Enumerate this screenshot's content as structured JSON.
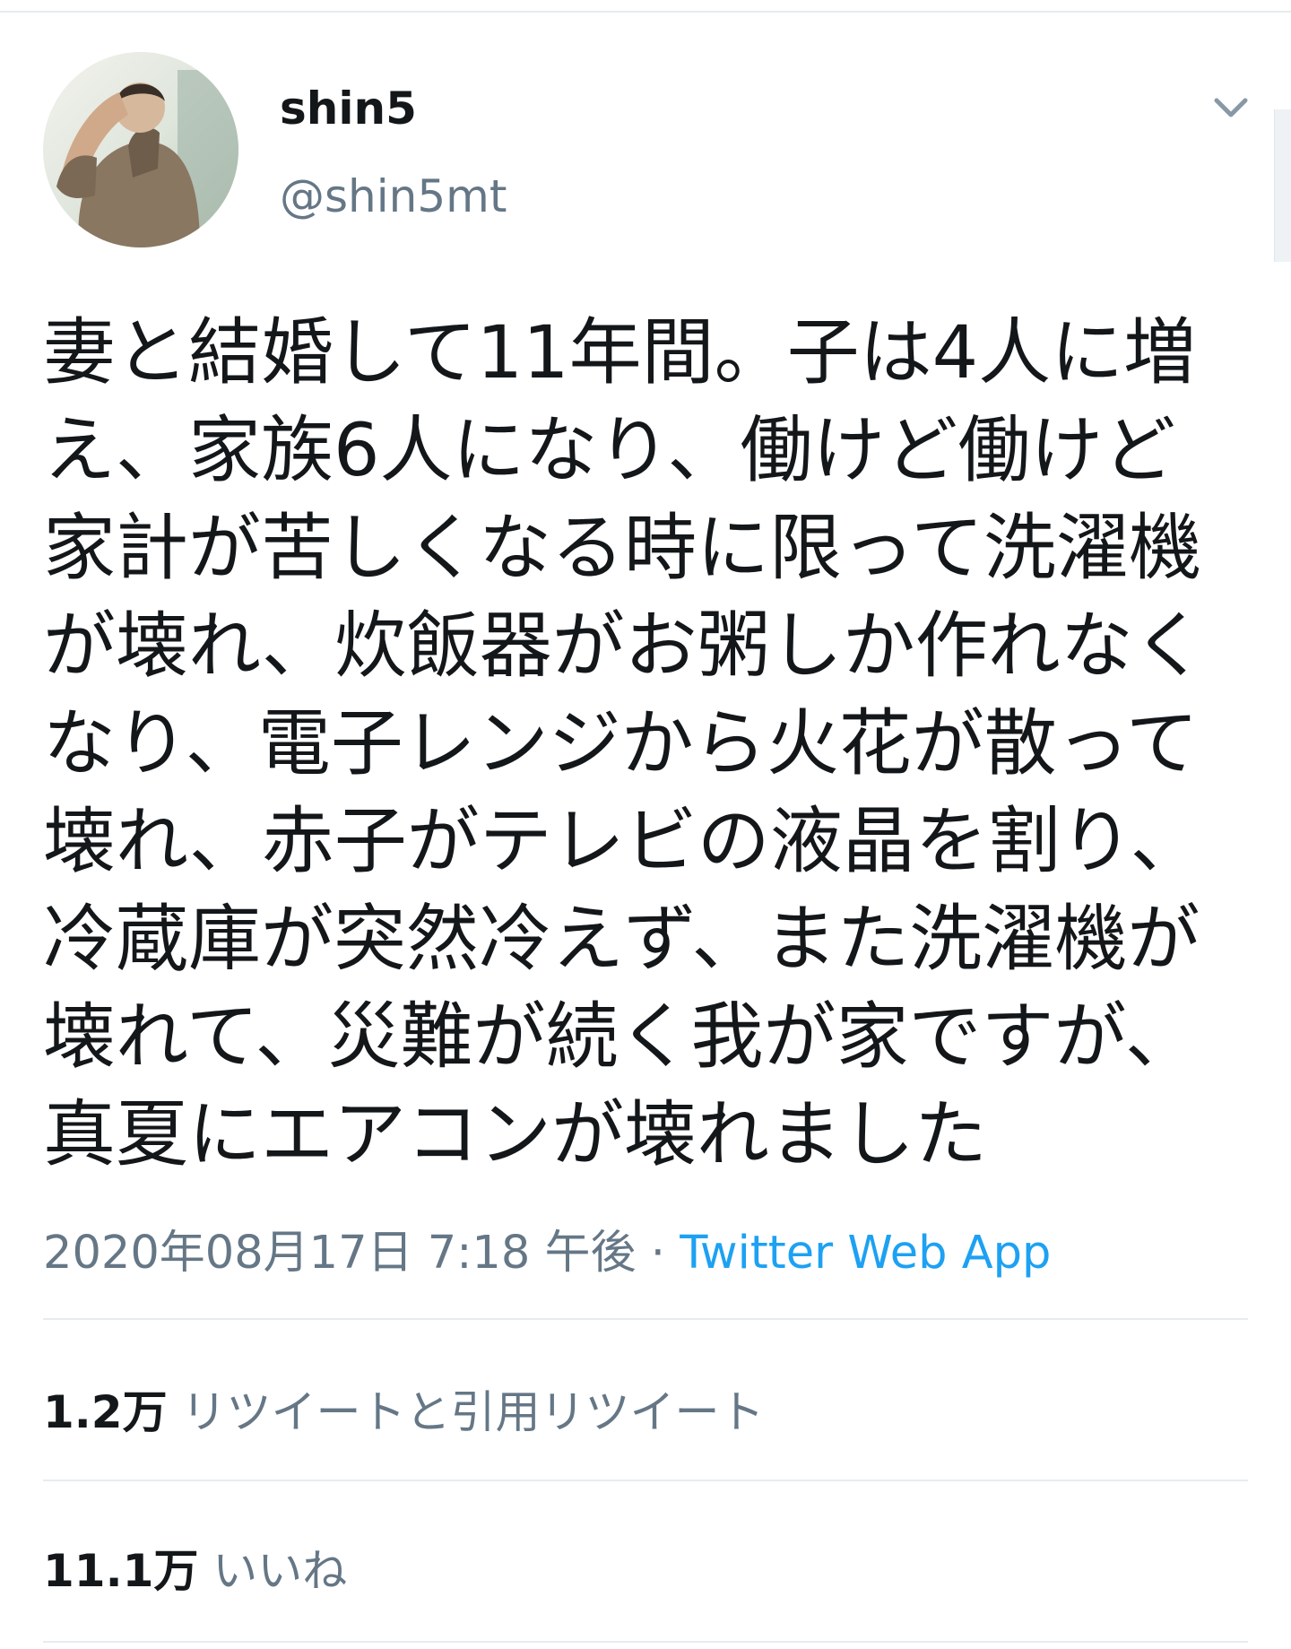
{
  "tweet": {
    "author": {
      "display_name": "shin5",
      "handle": "@shin5mt"
    },
    "text_lines": [
      "妻と結婚して11年間。子は4人に増",
      "え、家族6人になり、働けど働けど",
      "家計が苦しくなる時に限って洗濯機",
      "が壊れ、炊飯器がお粥しか作れなく",
      "なり、電子レンジから火花が散って",
      "壊れ、赤子がテレビの液晶を割り、",
      "冷蔵庫が突然冷えず、また洗濯機が",
      "壊れて、災難が続く我が家ですが、",
      "真夏にエアコンが壊れました"
    ],
    "timestamp": "2020年08月17日 7:18 午後",
    "separator": " · ",
    "source": "Twitter Web App",
    "stats": {
      "retweets": {
        "count": "1.2万",
        "label": "リツイートと引用リツイート"
      },
      "likes": {
        "count": "11.1万",
        "label": "いいね"
      }
    }
  },
  "icons": {
    "menu": "chevron-down-icon"
  },
  "colors": {
    "text": "#14171a",
    "secondary": "#657786",
    "link": "#1da1f2",
    "divider": "#e6ecf0"
  }
}
